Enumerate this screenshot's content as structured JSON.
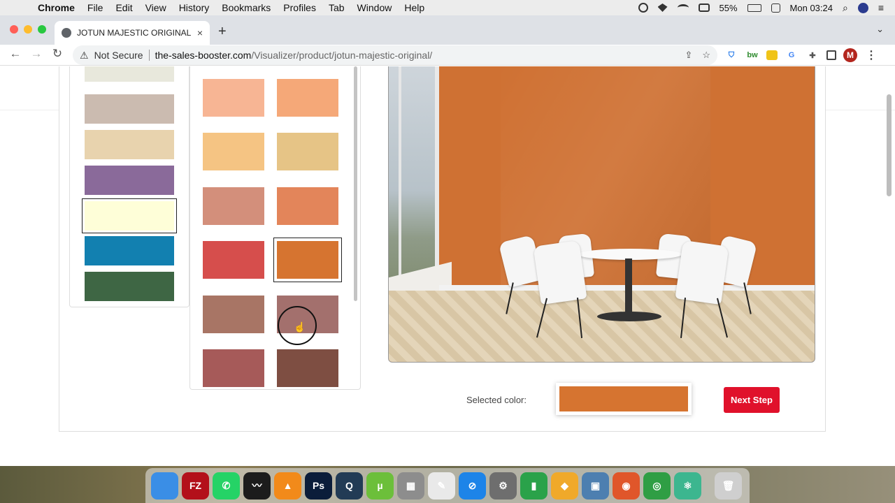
{
  "menubar": {
    "apple_glyph": "",
    "app_name": "Chrome",
    "items": [
      "File",
      "Edit",
      "View",
      "History",
      "Bookmarks",
      "Profiles",
      "Tab",
      "Window",
      "Help"
    ],
    "battery": "55%",
    "clock": "Mon 03:24"
  },
  "browser": {
    "tab_title": "JOTUN MAJESTIC ORIGINAL C",
    "tab_close": "×",
    "new_tab": "+",
    "security_label": "Not Secure",
    "url_host": "the-sales-booster.com",
    "url_path": "/Visualizer/product/jotun-majestic-original/",
    "profile_initial": "M",
    "ext_labels": [
      "bw"
    ]
  },
  "visualizer": {
    "column1_colors": [
      "#e8e8dc",
      "#cbbbb0",
      "#e8d3ae",
      "#8a6a9a",
      "#fefed8",
      "#1280b0",
      "#3e6644"
    ],
    "column1_selected_index": 4,
    "column2_colors": [
      "#f7b594",
      "#f5a878",
      "#f5c483",
      "#e6c486",
      "#d38f7b",
      "#e3855a",
      "#d64e4c",
      "#d67430",
      "#a87565",
      "#a3706d",
      "#a65a59",
      "#7e4e42"
    ],
    "column2_selected_index": 7,
    "wall_color": "#cf7133",
    "selected_label": "Selected color:",
    "selected_color": "#d67430",
    "next_button": "Next Step"
  },
  "dock": {
    "apps": [
      {
        "name": "finder-icon",
        "color": "#3a8ee6",
        "glyph": ""
      },
      {
        "name": "filezilla-icon",
        "color": "#b3101a",
        "glyph": "FZ"
      },
      {
        "name": "whatsapp-icon",
        "color": "#25d366",
        "glyph": "✆"
      },
      {
        "name": "activity-monitor-icon",
        "color": "#1c1c1c",
        "glyph": "〰"
      },
      {
        "name": "vlc-icon",
        "color": "#f28a1a",
        "glyph": "▲"
      },
      {
        "name": "photoshop-icon",
        "color": "#0b1d3a",
        "glyph": "Ps"
      },
      {
        "name": "quicktime-icon",
        "color": "#223b55",
        "glyph": "Q"
      },
      {
        "name": "utorrent-icon",
        "color": "#6cbf3a",
        "glyph": "µ"
      },
      {
        "name": "calculator-icon",
        "color": "#8d8d8d",
        "glyph": "▦"
      },
      {
        "name": "textedit-icon",
        "color": "#e9e9e9",
        "glyph": "✎"
      },
      {
        "name": "safari-icon",
        "color": "#1d84e8",
        "glyph": "⊘"
      },
      {
        "name": "system-preferences-icon",
        "color": "#6e6e6e",
        "glyph": "⚙"
      },
      {
        "name": "numbers-icon",
        "color": "#2aa24a",
        "glyph": "▮"
      },
      {
        "name": "sketch-icon",
        "color": "#f0a92a",
        "glyph": "◆"
      },
      {
        "name": "preview-icon",
        "color": "#4d7fb0",
        "glyph": "▣"
      },
      {
        "name": "firefox-icon",
        "color": "#e0562a",
        "glyph": "◉"
      },
      {
        "name": "chrome-icon",
        "color": "#2f9e44",
        "glyph": "◎"
      },
      {
        "name": "atom-icon",
        "color": "#3cb68f",
        "glyph": "⚛"
      },
      {
        "name": "trash-icon",
        "color": "#cfcfcf",
        "glyph": "🗑"
      }
    ]
  }
}
